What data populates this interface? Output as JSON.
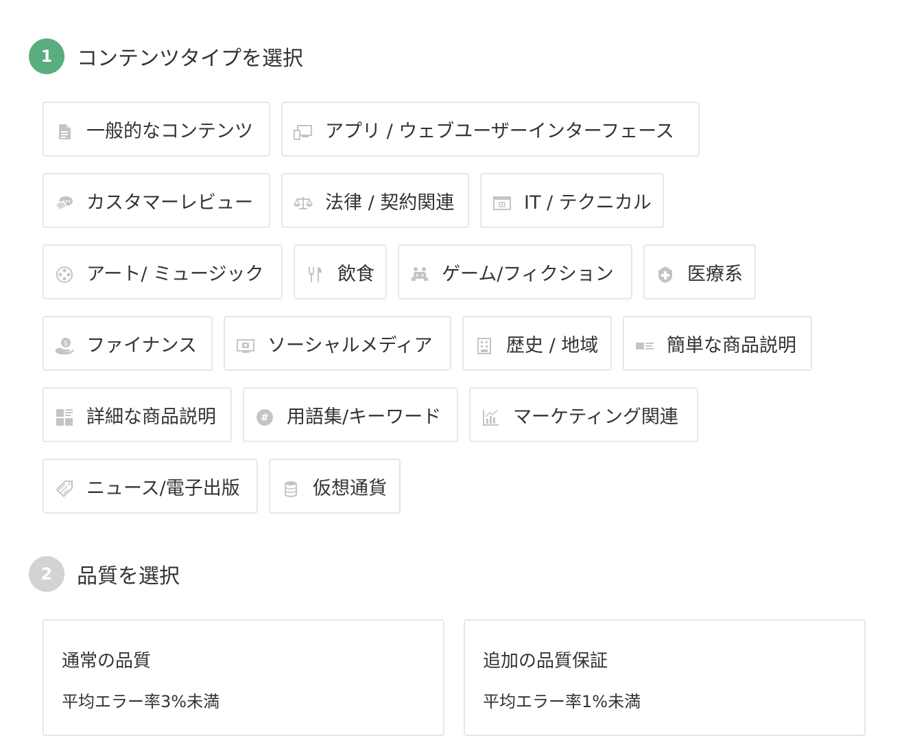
{
  "step1": {
    "number": "1",
    "title": "コンテンツタイプを選択"
  },
  "content_types": [
    {
      "label": "一般的なコンテンツ",
      "icon": "document-icon"
    },
    {
      "label": "アプリ / ウェブユーザーインターフェース",
      "icon": "devices-icon"
    },
    {
      "label": "カスタマーレビュー",
      "icon": "chat-icon"
    },
    {
      "label": "法律 / 契約関連",
      "icon": "scales-icon"
    },
    {
      "label": "IT / テクニカル",
      "icon": "browser-window-icon"
    },
    {
      "label": "アート/ ミュージック",
      "icon": "film-reel-icon"
    },
    {
      "label": "飲食",
      "icon": "utensils-icon"
    },
    {
      "label": "ゲーム/フィクション",
      "icon": "game-character-icon"
    },
    {
      "label": "医療系",
      "icon": "medical-shield-icon"
    },
    {
      "label": "ファイナンス",
      "icon": "money-hand-icon"
    },
    {
      "label": "ソーシャルメディア",
      "icon": "social-screen-icon"
    },
    {
      "label": "歴史 / 地域",
      "icon": "building-icon"
    },
    {
      "label": "簡単な商品説明",
      "icon": "product-card-icon"
    },
    {
      "label": "詳細な商品説明",
      "icon": "product-grid-icon"
    },
    {
      "label": "用語集/キーワード",
      "icon": "hashtag-icon"
    },
    {
      "label": "マーケティング関連",
      "icon": "bar-chart-icon"
    },
    {
      "label": "ニュース/電子出版",
      "icon": "tag-icon"
    },
    {
      "label": "仮想通貨",
      "icon": "coin-stack-icon"
    }
  ],
  "step2": {
    "number": "2",
    "title": "品質を選択"
  },
  "quality_options": [
    {
      "title": "通常の品質",
      "description": "平均エラー率3%未満"
    },
    {
      "title": "追加の品質保証",
      "description": "平均エラー率1%未満"
    }
  ],
  "colors": {
    "step_active": "#5aad7e",
    "step_inactive": "#d3d3d3",
    "border": "#e6e6e6",
    "icon": "#bdbdbd",
    "text": "#333333"
  }
}
